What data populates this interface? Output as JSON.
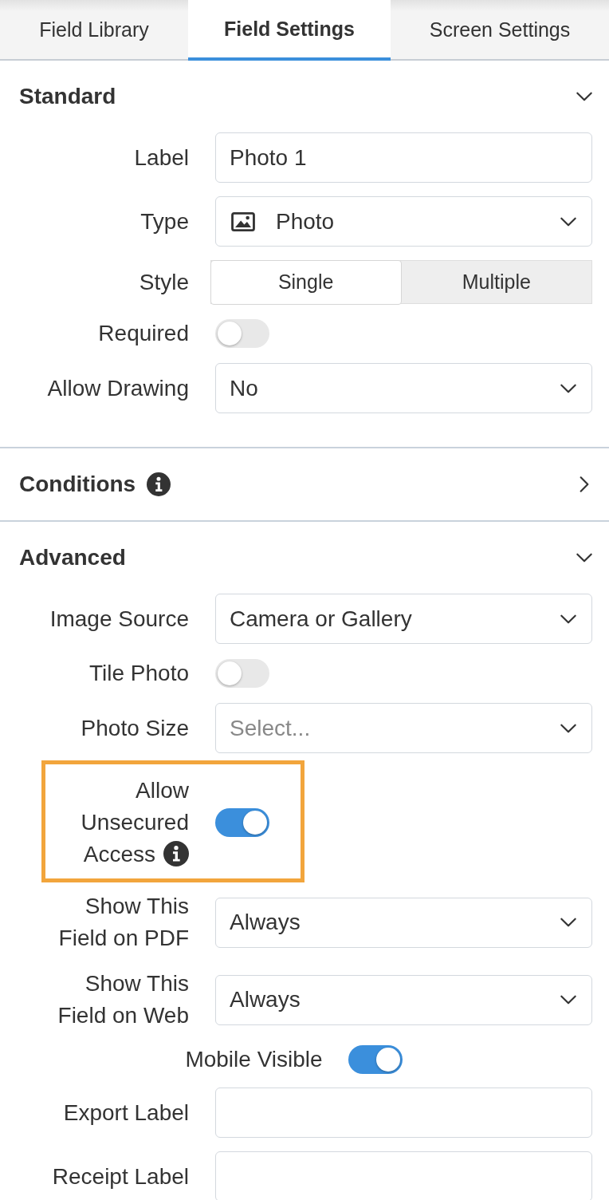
{
  "tabs": [
    {
      "label": "Field Library",
      "selected": false
    },
    {
      "label": "Field Settings",
      "selected": true
    },
    {
      "label": "Screen Settings",
      "selected": false
    }
  ],
  "sections": [
    {
      "title": "Standard",
      "expanded": true,
      "fields": [
        {
          "kind": "text",
          "label": "Label",
          "value": "Photo 1"
        },
        {
          "kind": "type-select",
          "label": "Type",
          "value": "Photo"
        },
        {
          "kind": "segmented",
          "label": "Style",
          "options": [
            {
              "label": "Single",
              "selected": true
            },
            {
              "label": "Multiple",
              "selected": false
            }
          ]
        },
        {
          "kind": "toggle",
          "label": "Required",
          "on": false
        },
        {
          "kind": "select",
          "label": "Allow Drawing",
          "value": "No"
        }
      ]
    },
    {
      "title": "Conditions",
      "expanded": false,
      "info": true
    },
    {
      "title": "Advanced",
      "expanded": true,
      "fields": [
        {
          "kind": "select",
          "label": "Image Source",
          "value": "Camera or Gallery"
        },
        {
          "kind": "toggle",
          "label": "Tile Photo",
          "on": false
        },
        {
          "kind": "select",
          "label": "Photo Size",
          "placeholder": "Select..."
        },
        {
          "kind": "toggle",
          "label": "Allow\nUnsecured\nAccess",
          "on": true,
          "info": true,
          "highlighted": true
        },
        {
          "kind": "select",
          "label": "Show This\nField on PDF",
          "value": "Always"
        },
        {
          "kind": "select",
          "label": "Show This\nField on Web",
          "value": "Always"
        },
        {
          "kind": "inline-toggle",
          "label": "Mobile Visible",
          "on": true
        },
        {
          "kind": "text",
          "label": "Export Label"
        },
        {
          "kind": "text",
          "label": "Receipt Label"
        }
      ]
    }
  ]
}
